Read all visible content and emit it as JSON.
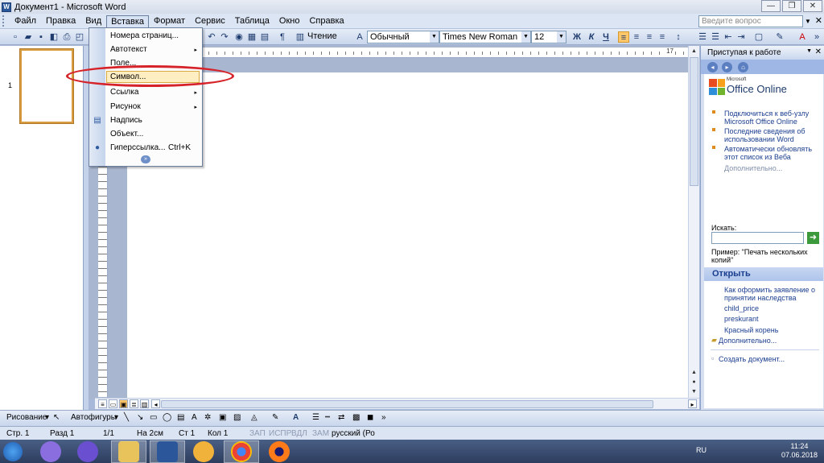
{
  "window": {
    "title": "Документ1 - Microsoft Word",
    "app_icon": "W",
    "controls": [
      "—",
      "❐",
      "✕"
    ]
  },
  "menubar": {
    "items": [
      "Файл",
      "Правка",
      "Вид",
      "Вставка",
      "Формат",
      "Сервис",
      "Таблица",
      "Окно",
      "Справка"
    ],
    "ask_placeholder": "Введите вопрос",
    "close_symbol": "✕"
  },
  "toolbar": {
    "reading_label": "Чтение",
    "style_value": "Обычный",
    "font_value": "Times New Roman",
    "size_value": "12",
    "bold": "Ж",
    "italic": "К",
    "underline": "Ч",
    "pilcrow": "¶"
  },
  "ruler": {
    "right_number": "17"
  },
  "thumbnail": {
    "page_number": "1"
  },
  "insert_menu": {
    "items": [
      {
        "label": "Номера страниц...",
        "submenu": false,
        "icon": ""
      },
      {
        "label": "Автотекст",
        "submenu": true,
        "icon": ""
      },
      {
        "label": "Поле...",
        "submenu": false,
        "icon": ""
      },
      {
        "label": "Символ...",
        "submenu": false,
        "icon": "",
        "highlighted": true
      },
      {
        "label": "Ссылка",
        "submenu": true,
        "icon": ""
      },
      {
        "label": "Рисунок",
        "submenu": true,
        "icon": ""
      },
      {
        "label": "Надпись",
        "submenu": false,
        "icon": "textbox-icon"
      },
      {
        "label": "Объект...",
        "submenu": false,
        "icon": ""
      },
      {
        "label": "Гиперссылка...",
        "submenu": false,
        "icon": "globe-link-icon",
        "shortcut": "Ctrl+K"
      }
    ],
    "submenu_arrow": "▸",
    "more_symbol": "»"
  },
  "taskpane": {
    "title": "Приступая к работе",
    "logo_ms": "Microsoft",
    "logo_name": "Office Online",
    "links": [
      "Подключиться к веб-узлу Microsoft Office Online",
      "Последние сведения об использовании Word",
      "Автоматически обновлять этот список из Веба"
    ],
    "more": "Дополнительно...",
    "search_label": "Искать:",
    "example": "Пример: \"Печать нескольких копий\"",
    "open_section": "Открыть",
    "recent": [
      "Как оформить заявление о принятии наследства",
      "child_price",
      "preskurant",
      "Красный корень"
    ],
    "open_more": "Дополнительно...",
    "create": "Создать документ..."
  },
  "drawbar": {
    "drawing": "Рисование",
    "autoshapes": "Автофигуры"
  },
  "status": {
    "page": "Стр. 1",
    "section": "Разд 1",
    "pages": "1/1",
    "at": "На 2см",
    "line": "Ст 1",
    "col": "Кол 1",
    "rec": "ЗАП",
    "trk": "ИСПР",
    "ext": "ВДЛ",
    "ovr": "ЗАМ",
    "lang": "русский (Ро"
  },
  "taskbar": {
    "lang": "RU",
    "time": "11:24",
    "date": "07.06.2018"
  }
}
